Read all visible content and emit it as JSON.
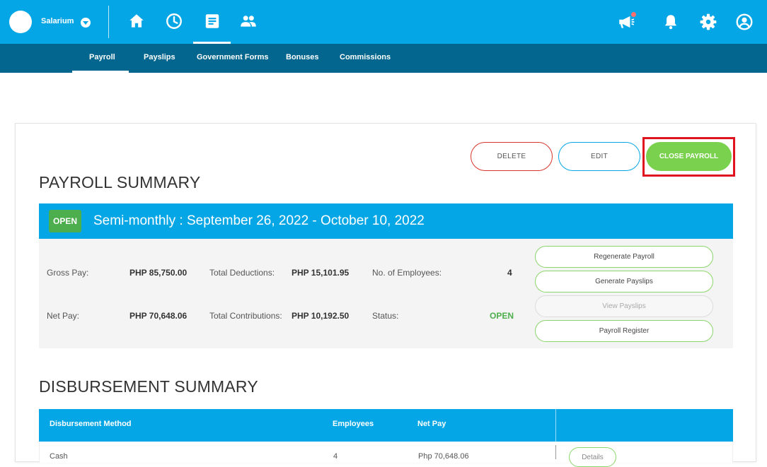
{
  "header": {
    "brand": "Salarium",
    "nav_icons": [
      "home-icon",
      "clock-icon",
      "document-icon",
      "people-icon"
    ],
    "right_icons": [
      "megaphone-icon",
      "bell-icon",
      "gear-icon",
      "user-icon"
    ]
  },
  "subnav": {
    "tabs": [
      {
        "label": "Payroll",
        "active": true
      },
      {
        "label": "Payslips"
      },
      {
        "label": "Government Forms"
      },
      {
        "label": "Bonuses"
      },
      {
        "label": "Commissions"
      }
    ]
  },
  "actions": {
    "delete_label": "DELETE",
    "edit_label": "EDIT",
    "close_label": "CLOSE PAYROLL"
  },
  "payroll_summary": {
    "title": "PAYROLL SUMMARY",
    "badge": "OPEN",
    "period": "Semi-monthly : September 26, 2022 - October 10, 2022",
    "gross_pay_label": "Gross Pay:",
    "gross_pay_value": "PHP 85,750.00",
    "total_deductions_label": "Total Deductions:",
    "total_deductions_value": "PHP 15,101.95",
    "employees_label": "No. of Employees:",
    "employees_value": "4",
    "net_pay_label": "Net Pay:",
    "net_pay_value": "PHP 70,648.06",
    "total_contributions_label": "Total Contributions:",
    "total_contributions_value": "PHP 10,192.50",
    "status_label": "Status:",
    "status_value": "OPEN",
    "buttons": {
      "regenerate": "Regenerate Payroll",
      "generate_payslips": "Generate Payslips",
      "view_payslips": "View Payslips",
      "payroll_register": "Payroll Register"
    }
  },
  "disbursement_summary": {
    "title": "DISBURSEMENT SUMMARY",
    "columns": [
      "Disbursement Method",
      "Employees",
      "Net Pay"
    ],
    "rows": [
      {
        "method": "Cash",
        "employees": "4",
        "net_pay": "Php 70,648.06",
        "action": "Details"
      }
    ]
  },
  "colors": {
    "primary": "#05a6e6",
    "subnav": "#02668e",
    "success": "#79d14d",
    "danger": "#d9342b",
    "highlight": "#e0141e"
  }
}
